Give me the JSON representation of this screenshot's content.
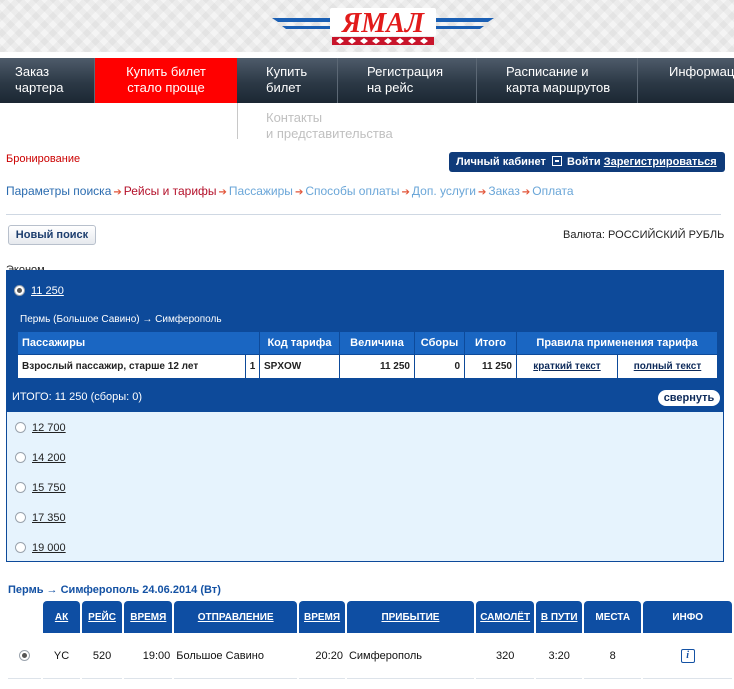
{
  "brand": {
    "logo_text": "ЯМАЛ",
    "accent": "#ff0000",
    "nav_blue": "#0d4a9a"
  },
  "nav": {
    "items": [
      {
        "line1": "Заказ",
        "line2": "чартера"
      },
      {
        "line1": "Купить билет",
        "line2": "стало проще"
      },
      {
        "line1": "Купить",
        "line2": "билет"
      },
      {
        "line1": "Регистрация",
        "line2": "на рейс"
      },
      {
        "line1": "Расписание и",
        "line2": "карта маршрутов"
      },
      {
        "line1": "Информац",
        "line2": ""
      }
    ],
    "submenu": {
      "line1": "Контакты",
      "line2": "и представительства"
    }
  },
  "booking": {
    "label": "Бронирование",
    "cabinet": {
      "title": "Личный кабинет",
      "login": "Войти",
      "register": "Зарегистрироваться"
    }
  },
  "steps": [
    "Параметры поиска",
    "Рейсы и тарифы",
    "Пассажиры",
    "Способы оплаты",
    "Доп. услуги",
    "Заказ",
    "Оплата"
  ],
  "search": {
    "new_search": "Новый поиск",
    "currency_label": "Валюта:",
    "currency_value": "РОССИЙСКИЙ РУБЛЬ"
  },
  "fare": {
    "class_label": "Эконом",
    "selected_price": "11 250",
    "route": "Пермь (Большое Савино) → Симферополь",
    "table": {
      "headers": [
        "Пассажиры",
        "Код тарифа",
        "Величина",
        "Сборы",
        "Итого",
        "Правила применения тарифа"
      ],
      "row": {
        "passenger": "Взрослый пассажир, старше 12 лет",
        "count": "1",
        "code": "SPXOW",
        "amount": "11 250",
        "fees": "0",
        "total": "11 250",
        "short_rules": "краткий текст",
        "full_rules": "полный текст"
      }
    },
    "total_line": "ИТОГО: 11 250 (сборы: 0)",
    "collapse": "свернуть",
    "other_prices": [
      "12 700",
      "14 200",
      "15 750",
      "17 350",
      "19 000"
    ]
  },
  "flights": {
    "title": "Пермь → Симферополь  24.06.2014 (Вт)",
    "headers": [
      "АК",
      "РЕЙС",
      "ВРЕМЯ",
      "ОТПРАВЛЕНИЕ",
      "ВРЕМЯ",
      "ПРИБЫТИЕ",
      "САМОЛЁТ",
      "В ПУТИ",
      "МЕСТА",
      "ИНФО"
    ],
    "rows": [
      {
        "carrier": "YC",
        "flight": "520",
        "dep_time": "19:00",
        "departure": "Большое Савино",
        "arr_time": "20:20",
        "arrival": "Симферополь",
        "aircraft": "320",
        "duration": "3:20",
        "seats": "8",
        "info": "i"
      }
    ]
  }
}
